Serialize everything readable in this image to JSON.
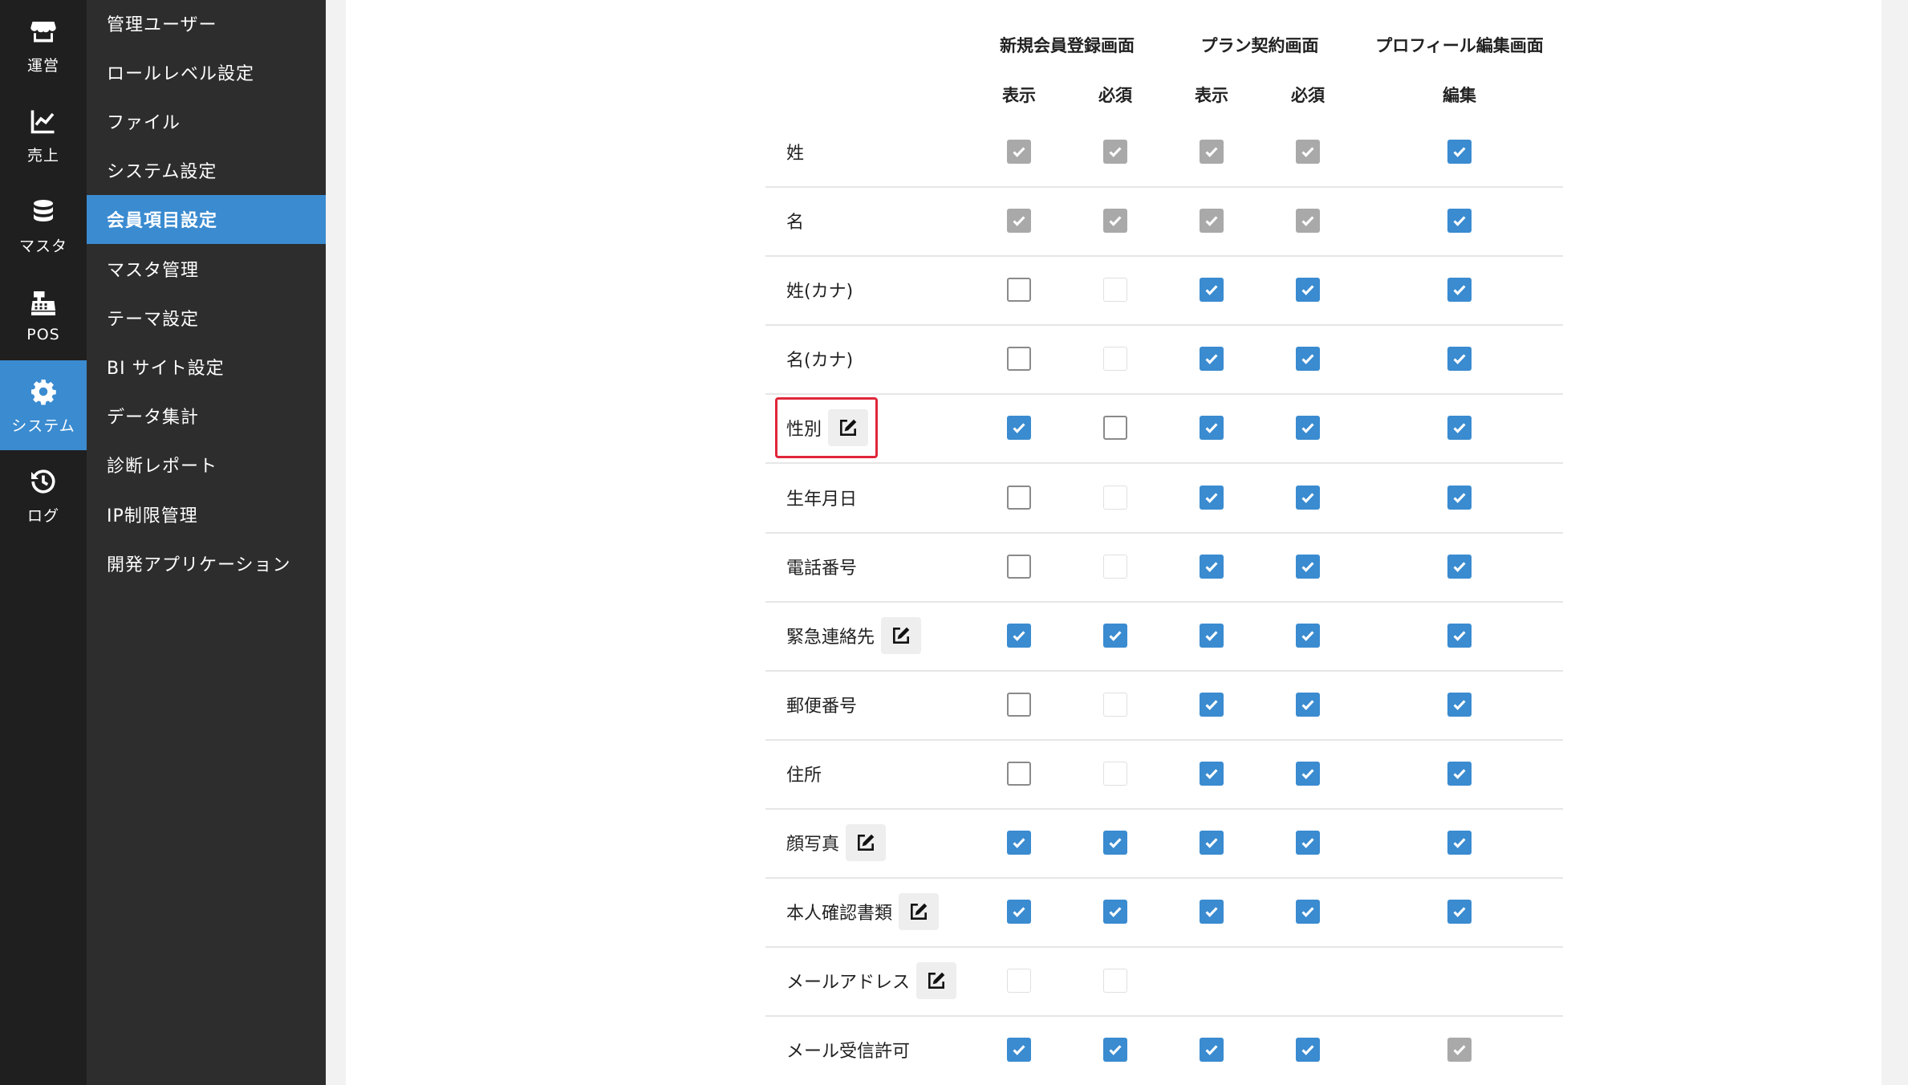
{
  "rail": [
    {
      "label": "運営",
      "icon": "store-icon",
      "active": false
    },
    {
      "label": "売上",
      "icon": "chart-line-icon",
      "active": false
    },
    {
      "label": "マスタ",
      "icon": "database-icon",
      "active": false
    },
    {
      "label": "POS",
      "icon": "cash-register-icon",
      "active": false
    },
    {
      "label": "システム",
      "icon": "gear-icon",
      "active": true
    },
    {
      "label": "ログ",
      "icon": "history-icon",
      "active": false
    }
  ],
  "submenu": [
    {
      "label": "管理ユーザー",
      "active": false
    },
    {
      "label": "ロールレベル設定",
      "active": false
    },
    {
      "label": "ファイル",
      "active": false
    },
    {
      "label": "システム設定",
      "active": false
    },
    {
      "label": "会員項目設定",
      "active": true
    },
    {
      "label": "マスタ管理",
      "active": false
    },
    {
      "label": "テーマ設定",
      "active": false
    },
    {
      "label": "BI サイト設定",
      "active": false
    },
    {
      "label": "データ集計",
      "active": false
    },
    {
      "label": "診断レポート",
      "active": false
    },
    {
      "label": "IP制限管理",
      "active": false
    },
    {
      "label": "開発アプリケーション",
      "active": false
    }
  ],
  "table": {
    "group_headers": [
      "新規会員登録画面",
      "プラン契約画面",
      "プロフィール編集画面"
    ],
    "sub_headers": [
      "表示",
      "必須",
      "表示",
      "必須",
      "編集"
    ],
    "rows": [
      {
        "label": "姓",
        "edit": false,
        "cells": [
          "gray",
          "gray",
          "gray",
          "gray",
          "on"
        ]
      },
      {
        "label": "名",
        "edit": false,
        "cells": [
          "gray",
          "gray",
          "gray",
          "gray",
          "on"
        ]
      },
      {
        "label": "姓(カナ)",
        "edit": false,
        "cells": [
          "off",
          "dis",
          "on",
          "on",
          "on"
        ]
      },
      {
        "label": "名(カナ)",
        "edit": false,
        "cells": [
          "off",
          "dis",
          "on",
          "on",
          "on"
        ]
      },
      {
        "label": "性別",
        "edit": true,
        "cells": [
          "on",
          "off",
          "on",
          "on",
          "on"
        ]
      },
      {
        "label": "生年月日",
        "edit": false,
        "cells": [
          "off",
          "dis",
          "on",
          "on",
          "on"
        ]
      },
      {
        "label": "電話番号",
        "edit": false,
        "cells": [
          "off",
          "dis",
          "on",
          "on",
          "on"
        ]
      },
      {
        "label": "緊急連絡先",
        "edit": true,
        "cells": [
          "on",
          "on",
          "on",
          "on",
          "on"
        ]
      },
      {
        "label": "郵便番号",
        "edit": false,
        "cells": [
          "off",
          "dis",
          "on",
          "on",
          "on"
        ]
      },
      {
        "label": "住所",
        "edit": false,
        "cells": [
          "off",
          "dis",
          "on",
          "on",
          "on"
        ]
      },
      {
        "label": "顔写真",
        "edit": true,
        "cells": [
          "on",
          "on",
          "on",
          "on",
          "on"
        ]
      },
      {
        "label": "本人確認書類",
        "edit": true,
        "cells": [
          "on",
          "on",
          "on",
          "on",
          "on"
        ]
      },
      {
        "label": "メールアドレス",
        "edit": true,
        "cells": [
          "dis",
          "dis",
          "none",
          "none",
          "none"
        ]
      },
      {
        "label": "メール受信許可",
        "edit": false,
        "cells": [
          "on",
          "on",
          "on",
          "on",
          "gray"
        ]
      }
    ]
  },
  "colors": {
    "accent": "#3a8bd0",
    "highlight": "#e0263a",
    "rail_bg": "#1f1f1f",
    "submenu_bg": "#2d2d2d"
  }
}
